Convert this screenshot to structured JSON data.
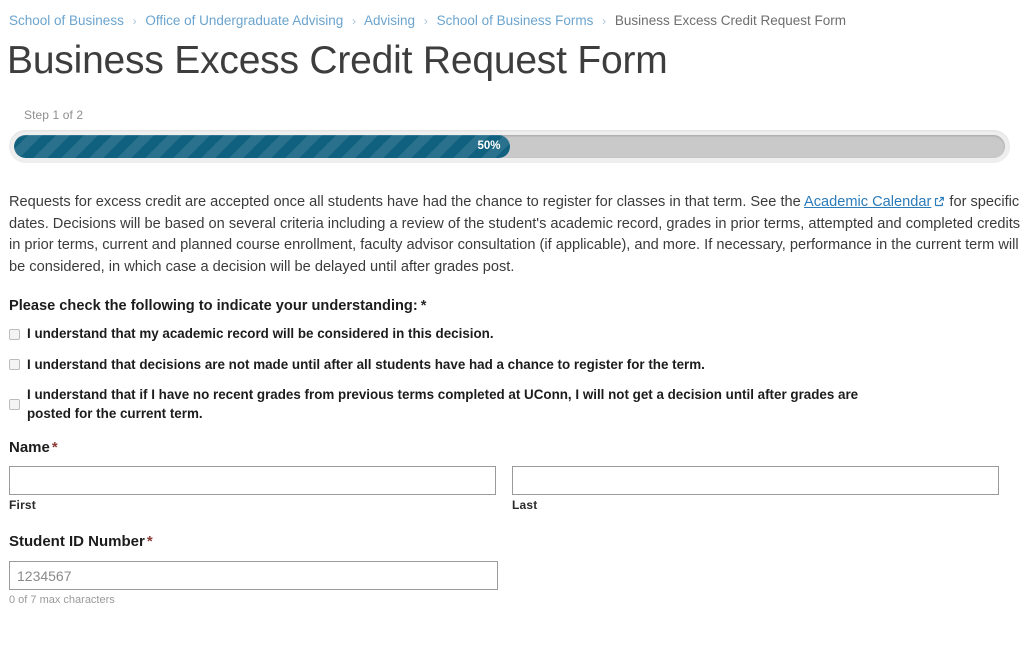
{
  "breadcrumb": {
    "separator": "›",
    "items": [
      {
        "label": "School of Business",
        "link": true
      },
      {
        "label": "Office of Undergraduate Advising",
        "link": true
      },
      {
        "label": "Advising",
        "link": true
      },
      {
        "label": "School of Business Forms",
        "link": true
      },
      {
        "label": "Business Excess Credit Request Form",
        "link": false
      }
    ]
  },
  "page": {
    "title": "Business Excess Credit Request Form"
  },
  "progress": {
    "step_label": "Step 1 of 2",
    "percent_label": "50%",
    "percent_value": 50,
    "fill_color": "#10607f",
    "track_color": "#c9c9c9",
    "container_color": "#eeeeee"
  },
  "intro": {
    "part1": "Requests for excess credit are accepted once all students have had the chance to register for classes in that term. See the ",
    "link_text": "Academic Calendar",
    "link_icon": "external-link-icon",
    "part2": " for specific dates. Decisions will be based on several criteria including a review of the student's academic record, grades in prior terms, attempted and completed credits in prior terms, current and planned course enrollment, faculty advisor consultation (if applicable), and more. If necessary, performance in the current term will be considered, in which case a decision will be delayed until after grades post.",
    "link_color": "#2b7bb9"
  },
  "understanding": {
    "label": "Please check the following to indicate your understanding:",
    "required_marker": "*",
    "options": [
      {
        "label": "I understand that my academic record will be considered in this decision.",
        "checked": false
      },
      {
        "label": "I understand that decisions are not made until after all students have had a chance to register for the term.",
        "checked": false
      },
      {
        "label": "I understand that if I have no recent grades from previous terms completed at UConn, I will not get a decision until after grades are posted for the current term.",
        "checked": false
      }
    ]
  },
  "name_field": {
    "label": "Name",
    "required_marker": "*",
    "first": {
      "sub_label": "First",
      "value": "",
      "placeholder": ""
    },
    "last": {
      "sub_label": "Last",
      "value": "",
      "placeholder": ""
    }
  },
  "student_id": {
    "label": "Student ID Number",
    "required_marker": "*",
    "value": "",
    "placeholder": "1234567",
    "hint": "0 of 7 max characters"
  }
}
